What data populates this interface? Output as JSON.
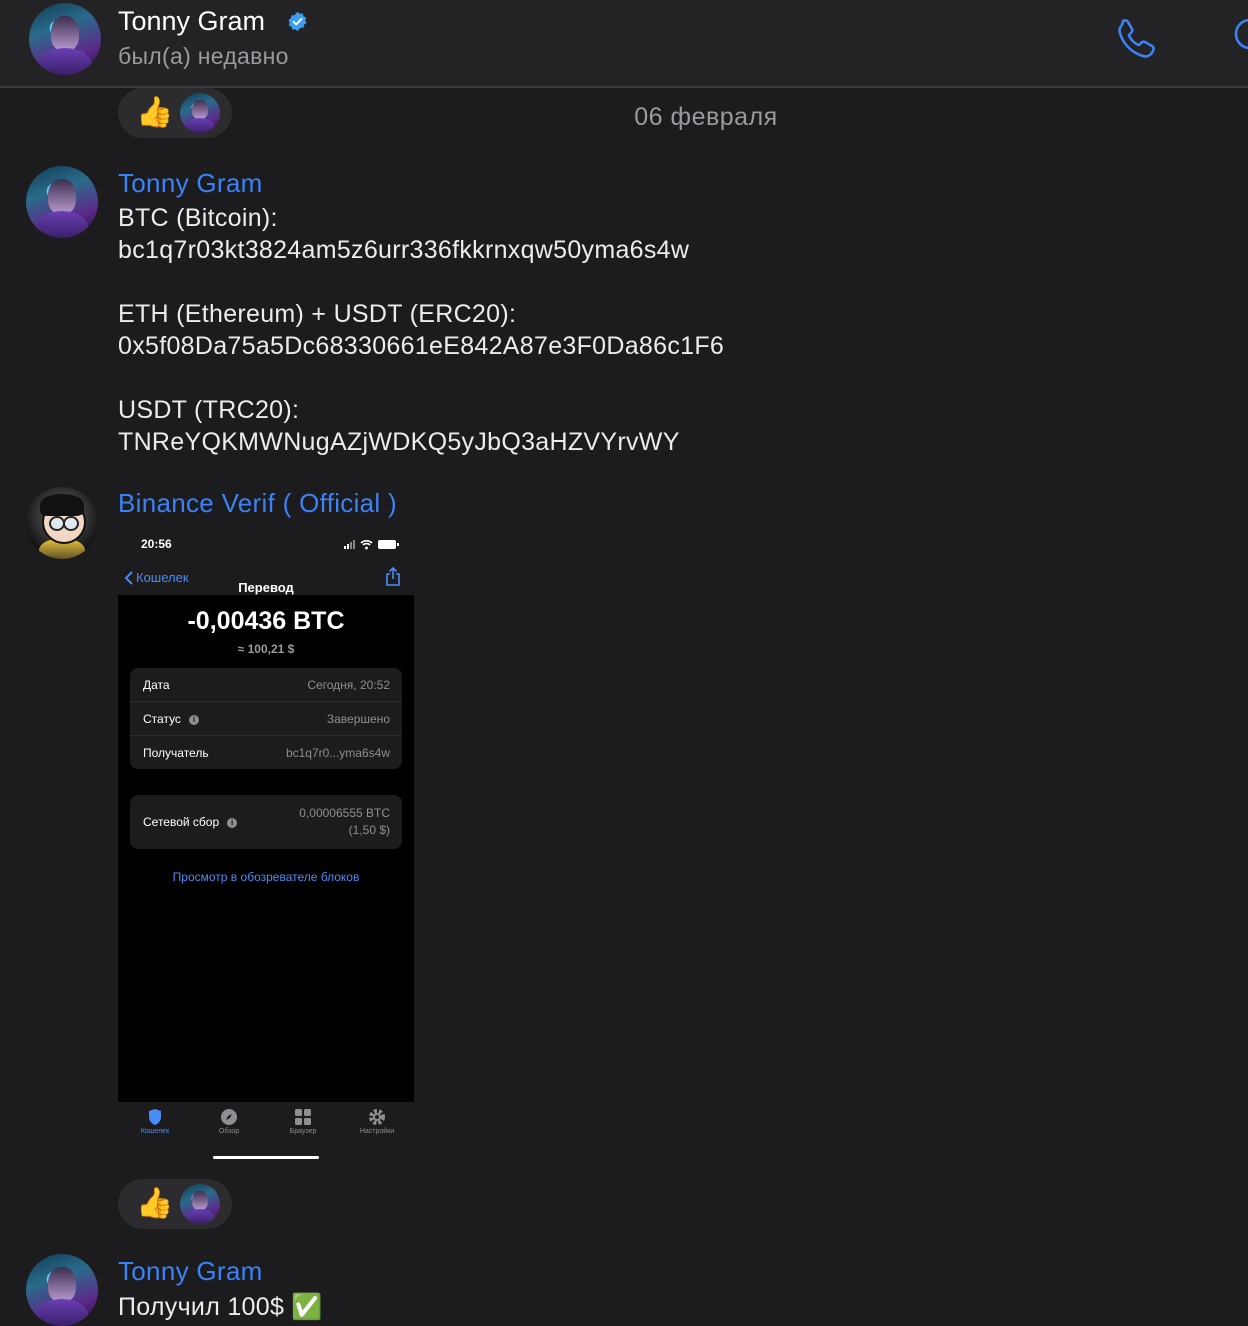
{
  "header": {
    "name": "Tonny Gram",
    "status": "был(а) недавно"
  },
  "date_separator": "06 февраля",
  "reactions": {
    "emoji": "👍"
  },
  "messages": [
    {
      "sender": "Tonny Gram",
      "lines": [
        "BTC (Bitcoin):",
        "bc1q7r03kt3824am5z6urr336fkkrnxqw50yma6s4w",
        "ETH (Ethereum) + USDT (ERC20):",
        "0x5f08Da75a5Dc68330661eE842A87e3F0Da86c1F6",
        "USDT (TRC20):",
        "TNReYQKMWNugAZjWDKQ5yJbQ3aHZVYrvWY"
      ]
    },
    {
      "sender": "Binance Verif ( Official )",
      "screenshot": {
        "time": "20:56",
        "back_label": "Кошелек",
        "nav_title": "Перевод",
        "amount": "-0,00436 BTC",
        "fiat": "≈ 100,21 $",
        "rows": [
          {
            "key": "Дата",
            "value": "Сегодня, 20:52"
          },
          {
            "key": "Статус",
            "value": "Завершено"
          },
          {
            "key": "Получатель",
            "value": "bc1q7r0...yma6s4w"
          }
        ],
        "fee": {
          "key": "Сетевой сбор",
          "value_line1": "0,00006555 BTC",
          "value_line2": "(1,50 $)"
        },
        "explorer_link": "Просмотр в обозревателе блоков",
        "tabs": [
          "Кошелек",
          "Обзор",
          "Браузер",
          "Настройки"
        ]
      }
    },
    {
      "sender": "Tonny Gram",
      "text": "Получил 100$ ✅"
    }
  ],
  "colors": {
    "background": "#1c1c1e",
    "header": "#232325",
    "accent": "#3b82f6",
    "muted": "#9a9a9f"
  }
}
